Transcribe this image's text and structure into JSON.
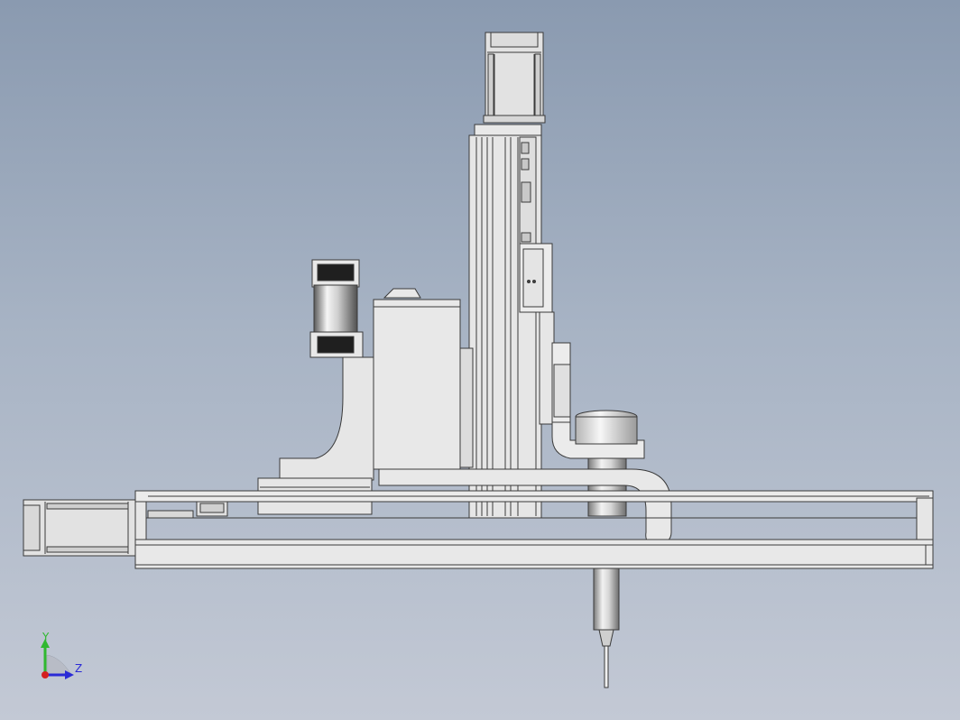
{
  "triad": {
    "y_label": "Y",
    "z_label": "Z",
    "y_color": "#2fb82f",
    "z_color": "#2a2ad6",
    "x_color": "#d42020"
  },
  "palette": {
    "part_fill": "#e4e4e4",
    "part_light": "#ededed",
    "part_shade": "#cfcfcf",
    "outline": "#3a3a3a",
    "dark": "#222222"
  }
}
